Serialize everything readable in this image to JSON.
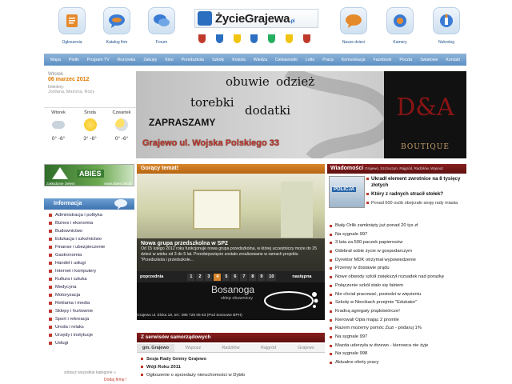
{
  "header": {
    "icons": [
      {
        "label": "Ogłoszenia",
        "icon": "notepad-icon",
        "color": "#e58a2b"
      },
      {
        "label": "Katalog firm",
        "icon": "chat-bubble-icon",
        "color": "#3a7bd5"
      },
      {
        "label": "Forum",
        "icon": "forum-icon",
        "color": "#3a7bd5"
      },
      {
        "label": "Nasze dzieci",
        "icon": "chat-bubble-icon",
        "color": "#e58a2b"
      },
      {
        "label": "Kamery",
        "icon": "camera-icon",
        "color": "#3a7bd5"
      },
      {
        "label": "Nekrolog",
        "icon": "candle-icon",
        "color": "#3a7bd5"
      }
    ],
    "logo_text": "ŻycieGrajewa",
    "logo_suffix": ".pl",
    "crest_colors": [
      "#c0392b",
      "#2b6fc0",
      "#f1c40f",
      "#2b6fc0",
      "#27ae60",
      "#f1c40f",
      "#c0392b"
    ]
  },
  "nav": {
    "items": [
      "Mapa",
      "Piotki",
      "Program TV",
      "Rozrywka",
      "Zakupy",
      "Kino",
      "Przedszkola",
      "Szkoły",
      "Kolarta",
      "Wiedza",
      "Ciekawostki",
      "Lotto",
      "Praca",
      "Komunikacja",
      "Facebook",
      "Poczta",
      "Swiatowe",
      "Kontakt"
    ]
  },
  "date": {
    "weekday": "Wtorek",
    "date": "06 marzec 2012",
    "nameday_label": "Imieniny:",
    "names": "Jordana, Marcina, Róży"
  },
  "weather": [
    {
      "day": "Wtorek",
      "temp": "0° -6°",
      "icon": "cloud-icon",
      "color": "#c9d3dc"
    },
    {
      "day": "Środa",
      "temp": "3° -6°",
      "icon": "sun-icon",
      "color": "#f5c518"
    },
    {
      "day": "Czwartek",
      "temp": "0° -6°",
      "icon": "sun-cloud-icon",
      "color": "#f2d35e"
    }
  ],
  "abies": {
    "title": "ABIES",
    "left_text": "zakładanie zieleni",
    "url": "www.abies.net.pl"
  },
  "info": {
    "title": "Informacja",
    "items": [
      "Administracja i polityka",
      "Biznes i ekonomia",
      "Budownictwo",
      "Edukacja i szkolnictwo",
      "Finanse i ubezpieczenie",
      "Gastronomia",
      "Handel i usługi",
      "Internet i komputery",
      "Kultura i sztuka",
      "Medycyna",
      "Motoryzacja",
      "Reklama i media",
      "Sklepy i hurtownie",
      "Sport i rekreacja",
      "Uroda i relaks",
      "Urzędy i instytucje",
      "Usługi"
    ],
    "more": "zobacz wszystkie kategorie »",
    "add": "Dodaj firmę !"
  },
  "banner": {
    "line1": "obuwie",
    "line1b": "odzież",
    "line2": "torebki",
    "line3": "dodatki",
    "invite": "ZAPRASZAMY",
    "address": "Grajewo ul. Wojska Polskiego 33",
    "brand": "D&A",
    "brand_sub": "BOUTIQUE"
  },
  "hot": {
    "title": "Gorący temat!",
    "headline": "Nowa grupa przedszkolna w SP2",
    "excerpt": "Od 15 lutego 2012 roku funkcjonuje nowa grupa przedszkolna, w której uczestniczy może do 25 dzieci w wieku od 3 do 5 lat. Przedsięwzięcie zostało zrealizowane w ramach projektu \"Przedszkola i przedszkole...",
    "prev": "poprzednia",
    "next": "następna",
    "pages": [
      "1",
      "2",
      "3",
      "4",
      "5",
      "6",
      "7",
      "8",
      "9",
      "10"
    ],
    "active_page": "4"
  },
  "bosa": {
    "title": "Bosanoga",
    "subtitle": "sklep obuwniczy",
    "address": "Grajewo ul. Elcka 18, tel.: 086 725 05 63 (Pod Sosnowe BPH)"
  },
  "services": {
    "title": "Z serwisów samorządowych",
    "tabs": [
      "gm. Grajewo",
      "Wąsosz",
      "Radziłów",
      "Rajgród",
      "Grajewo"
    ],
    "active_tab": "gm. Grajewo",
    "items": [
      "Sesja Rady Gminy Grajewo",
      "Wójt Roku 2011",
      "Ogłoszenie o sprzedaży nieruchomości w Dybło"
    ]
  },
  "news": {
    "title": "Wiadomości",
    "subtitle": "Grajewo, Szczuczyn, Rajgród, Radziłów, Wąsosz",
    "policja": "POLICJA",
    "top": [
      "Ukradł element zwrotnice na 8 tysięcy złotych",
      "Który z radnych stracił stołek?"
    ],
    "top_small": "Ponad 600 osób obejrzało sesję rady miasta",
    "items": [
      "Biały Orlik zamknięty już ponad 20 tys zł",
      "Na sygnale 997",
      "3 lata za 500 paczek papierosów",
      "Odebrał sobie życie w gospodarczym",
      "Dyrektor MDK otrzymał wypowiedzenie",
      "Przerwy w dostawie prądu",
      "Nowe obwody szkół zwiększył rozsadek nad porażkę",
      "Połączenie szkół stało się faktem",
      "Nie chciał pracować, posiedzi w więzieniu",
      "Szkolę w Niecikach przejmie \"Edukator\"",
      "Kradną agregaty prądotwórcze!",
      "Kierowali Opla mając 2 promile",
      "Razem możemy pomóc Zuzi - podaruj 1%",
      "Na sygnale 997",
      "Mazda uderzyła w drzewo - kierowca nie żyje",
      "Na sygnale 998",
      "Aktualne oferty pracy"
    ]
  }
}
